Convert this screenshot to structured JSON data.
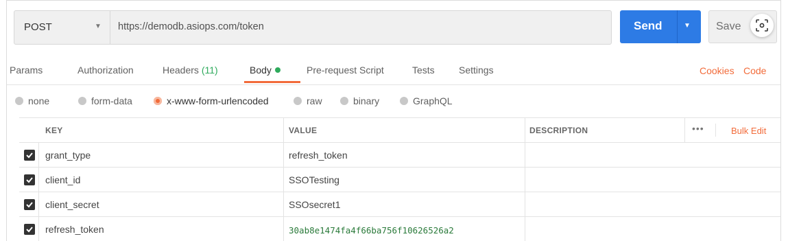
{
  "request": {
    "method": "POST",
    "url": "https://demodb.asiops.com/token",
    "send_label": "Send",
    "save_label": "Save"
  },
  "tabs": [
    {
      "label": "Params"
    },
    {
      "label": "Authorization"
    },
    {
      "label": "Headers",
      "count": "(11)"
    },
    {
      "label": "Body"
    },
    {
      "label": "Pre-request Script"
    },
    {
      "label": "Tests"
    },
    {
      "label": "Settings"
    }
  ],
  "tab_links": {
    "cookies": "Cookies",
    "code": "Code"
  },
  "body_types": [
    "none",
    "form-data",
    "x-www-form-urlencoded",
    "raw",
    "binary",
    "GraphQL"
  ],
  "selected_body_type": "x-www-form-urlencoded",
  "table": {
    "headers": {
      "key": "KEY",
      "value": "VALUE",
      "description": "DESCRIPTION",
      "more": "•••",
      "bulk_edit": "Bulk Edit"
    },
    "rows": [
      {
        "key": "grant_type",
        "value": "refresh_token",
        "checked": true
      },
      {
        "key": "client_id",
        "value": "SSOTesting",
        "checked": true
      },
      {
        "key": "client_secret",
        "value": "SSOsecret1",
        "checked": true
      },
      {
        "key": "refresh_token",
        "value": "30ab8e1474fa4f66ba756f10626526a2",
        "checked": true
      }
    ]
  },
  "colors": {
    "accent": "#f26b3a",
    "send": "#2d7be5",
    "active_dot": "#2eaa5c"
  }
}
